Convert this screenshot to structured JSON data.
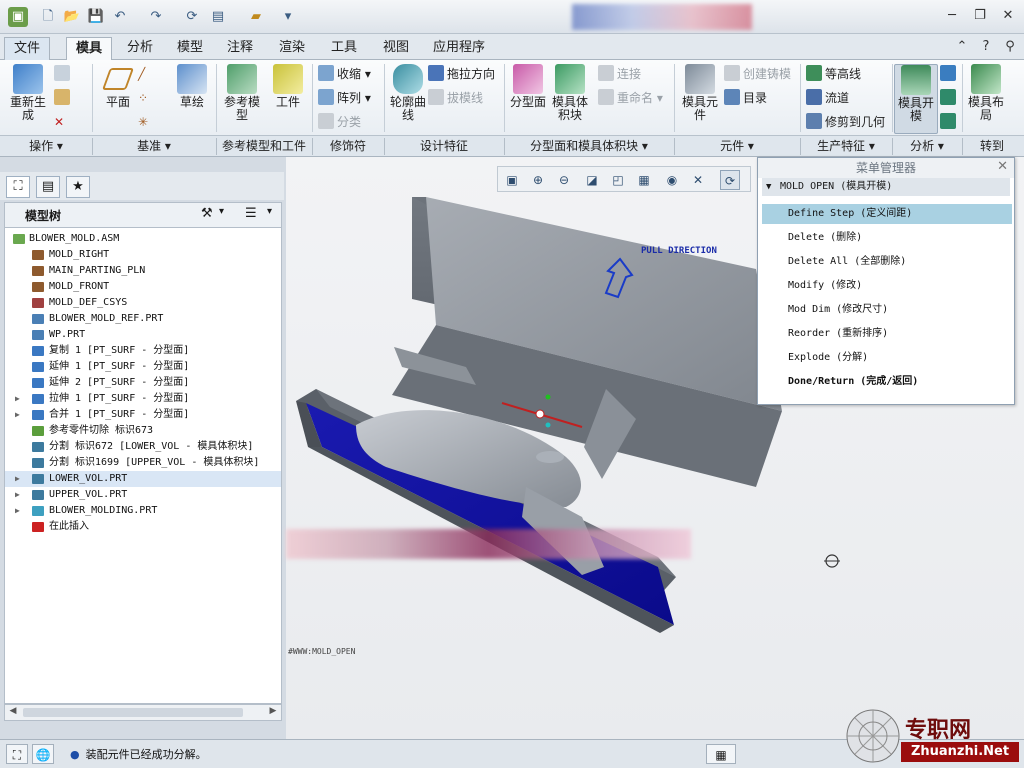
{
  "quick_access": {
    "icons": [
      "app-icon",
      "new-icon",
      "open-icon",
      "save-icon",
      "undo-icon",
      "redo-icon",
      "regenerate-icon",
      "windows-icon",
      "close-window-icon",
      "customize-icon"
    ]
  },
  "tabs": [
    "文件",
    "模具",
    "分析",
    "模型",
    "注释",
    "渲染",
    "工具",
    "视图",
    "应用程序"
  ],
  "ribbon": {
    "operations": {
      "regen": "重新生成",
      "group": "操作"
    },
    "datum": {
      "plane": "平面",
      "sketch": "草绘",
      "group": "基准"
    },
    "ref_model": {
      "ref": "参考模型",
      "workpiece": "工件",
      "group": "参考模型和工件"
    },
    "modifiers": {
      "shrink": "收缩",
      "pattern": "阵列",
      "classify": "分类",
      "group": "修饰符"
    },
    "design": {
      "contour": "轮廓曲线",
      "pull_dir": "拖拉方向",
      "draft_line": "拔模线",
      "group": "设计特征"
    },
    "parting": {
      "surface": "分型面",
      "volume": "模具体积块",
      "connect": "连接",
      "rename": "重命名",
      "group": "分型面和模具体积块"
    },
    "components": {
      "element": "模具元件",
      "create_cast": "创建铸模",
      "catalog": "目录",
      "group": "元件"
    },
    "production": {
      "contour_line": "等高线",
      "flow": "流道",
      "trim": "修剪到几何",
      "group": "生产特征"
    },
    "analysis": {
      "mold_open": "模具开模",
      "group": "分析"
    },
    "goto": {
      "layout": "模具布局",
      "group": "转到"
    }
  },
  "model_tree": {
    "title": "模型树",
    "items": [
      {
        "label": "BLOWER_MOLD.ASM",
        "expand": "",
        "color": "#6aa84f"
      },
      {
        "label": "MOLD_RIGHT",
        "expand": "",
        "color": "#8e5a2e"
      },
      {
        "label": "MAIN_PARTING_PLN",
        "expand": "",
        "color": "#8e5a2e"
      },
      {
        "label": "MOLD_FRONT",
        "expand": "",
        "color": "#8e5a2e"
      },
      {
        "label": "MOLD_DEF_CSYS",
        "expand": "",
        "color": "#a04040"
      },
      {
        "label": "BLOWER_MOLD_REF.PRT",
        "expand": "",
        "color": "#4a7fb5"
      },
      {
        "label": "WP.PRT",
        "expand": "",
        "color": "#4a7fb5"
      },
      {
        "label": "复制 1 [PT_SURF - 分型面]",
        "expand": "",
        "color": "#3a78c2"
      },
      {
        "label": "延伸 1 [PT_SURF - 分型面]",
        "expand": "",
        "color": "#3a78c2"
      },
      {
        "label": "延伸 2 [PT_SURF - 分型面]",
        "expand": "",
        "color": "#3a78c2"
      },
      {
        "label": "拉伸 1 [PT_SURF - 分型面]",
        "expand": "▶",
        "color": "#3a78c2"
      },
      {
        "label": "合并 1 [PT_SURF - 分型面]",
        "expand": "▶",
        "color": "#3a78c2"
      },
      {
        "label": "参考零件切除 标识673",
        "expand": "",
        "color": "#5b9e3c"
      },
      {
        "label": "分割 标识672 [LOWER_VOL - 模具体积块]",
        "expand": "",
        "color": "#3d7a9e"
      },
      {
        "label": "分割 标识1699 [UPPER_VOL - 模具体积块]",
        "expand": "",
        "color": "#3d7a9e"
      },
      {
        "label": "LOWER_VOL.PRT",
        "expand": "▶",
        "color": "#3d7a9e"
      },
      {
        "label": "UPPER_VOL.PRT",
        "expand": "▶",
        "color": "#3d7a9e"
      },
      {
        "label": "BLOWER_MOLDING.PRT",
        "expand": "▶",
        "color": "#3da0c0"
      },
      {
        "label": "在此插入",
        "expand": "",
        "color": "#cc2222"
      }
    ]
  },
  "graphics": {
    "pull_direction": "PULL DIRECTION",
    "view_label": "#WWW:MOLD_OPEN"
  },
  "menu_manager": {
    "title": "菜单管理器",
    "submenu": "MOLD OPEN (模具开模)",
    "items": [
      {
        "label": "Define Step (定义间距)",
        "selected": true,
        "bold": false
      },
      {
        "label": "Delete (删除)",
        "selected": false,
        "bold": false
      },
      {
        "label": "Delete All (全部删除)",
        "selected": false,
        "bold": false
      },
      {
        "label": "Modify (修改)",
        "selected": false,
        "bold": false
      },
      {
        "label": "Mod Dim (修改尺寸)",
        "selected": false,
        "bold": false
      },
      {
        "label": "Reorder (重新排序)",
        "selected": false,
        "bold": false
      },
      {
        "label": "Explode (分解)",
        "selected": false,
        "bold": false
      },
      {
        "label": "Done/Return (完成/返回)",
        "selected": false,
        "bold": true
      }
    ]
  },
  "status": {
    "message": "装配元件已经成功分解。"
  },
  "watermark": {
    "text": "专职网",
    "url": "Zhuanzhi.Net"
  }
}
